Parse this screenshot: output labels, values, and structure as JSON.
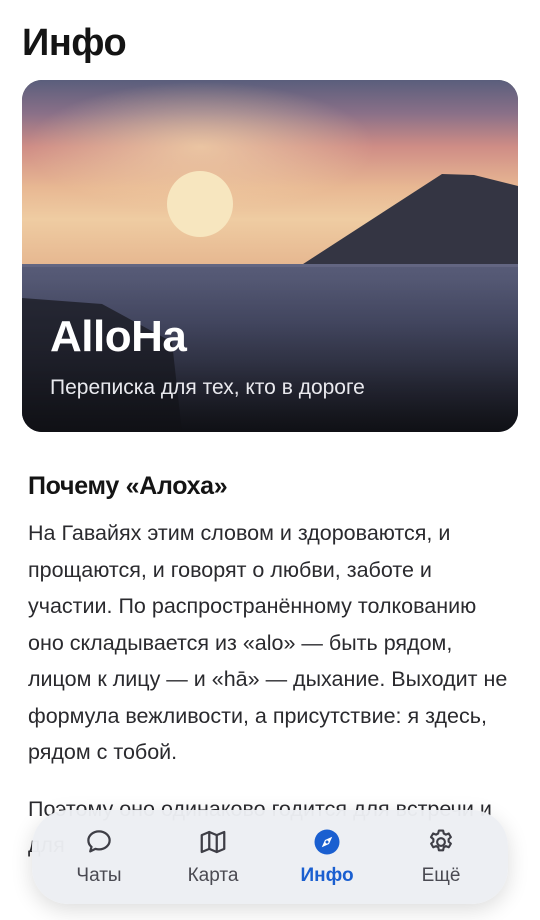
{
  "page": {
    "title": "Инфо"
  },
  "hero": {
    "title": "AlloHa",
    "subtitle": "Переписка для тех, кто в дороге"
  },
  "section": {
    "title": "Почему «Алоха»",
    "body": "На Гавайях этим словом и здороваются, и прощаются, и говорят о любви, заботе и участии. По распространённому толкованию оно складывается из «alo» — быть рядом, лицом к лицу — и «hā» — дыхание. Выходит не формула вежливости, а присутствие: я здесь, рядом с тобой.",
    "body2": "Поэтому оно одинаково годится для встречи и для"
  },
  "tabbar": {
    "tabs": [
      {
        "id": "chats",
        "label": "Чаты",
        "icon": "chat-bubble-icon",
        "active": false
      },
      {
        "id": "map",
        "label": "Карта",
        "icon": "map-icon",
        "active": false
      },
      {
        "id": "info",
        "label": "Инфо",
        "icon": "compass-icon",
        "active": true
      },
      {
        "id": "more",
        "label": "Ещё",
        "icon": "gear-icon",
        "active": false
      }
    ]
  },
  "colors": {
    "accent": "#1a5fd0",
    "inactive": "#4a4a52",
    "text": "#141414"
  }
}
